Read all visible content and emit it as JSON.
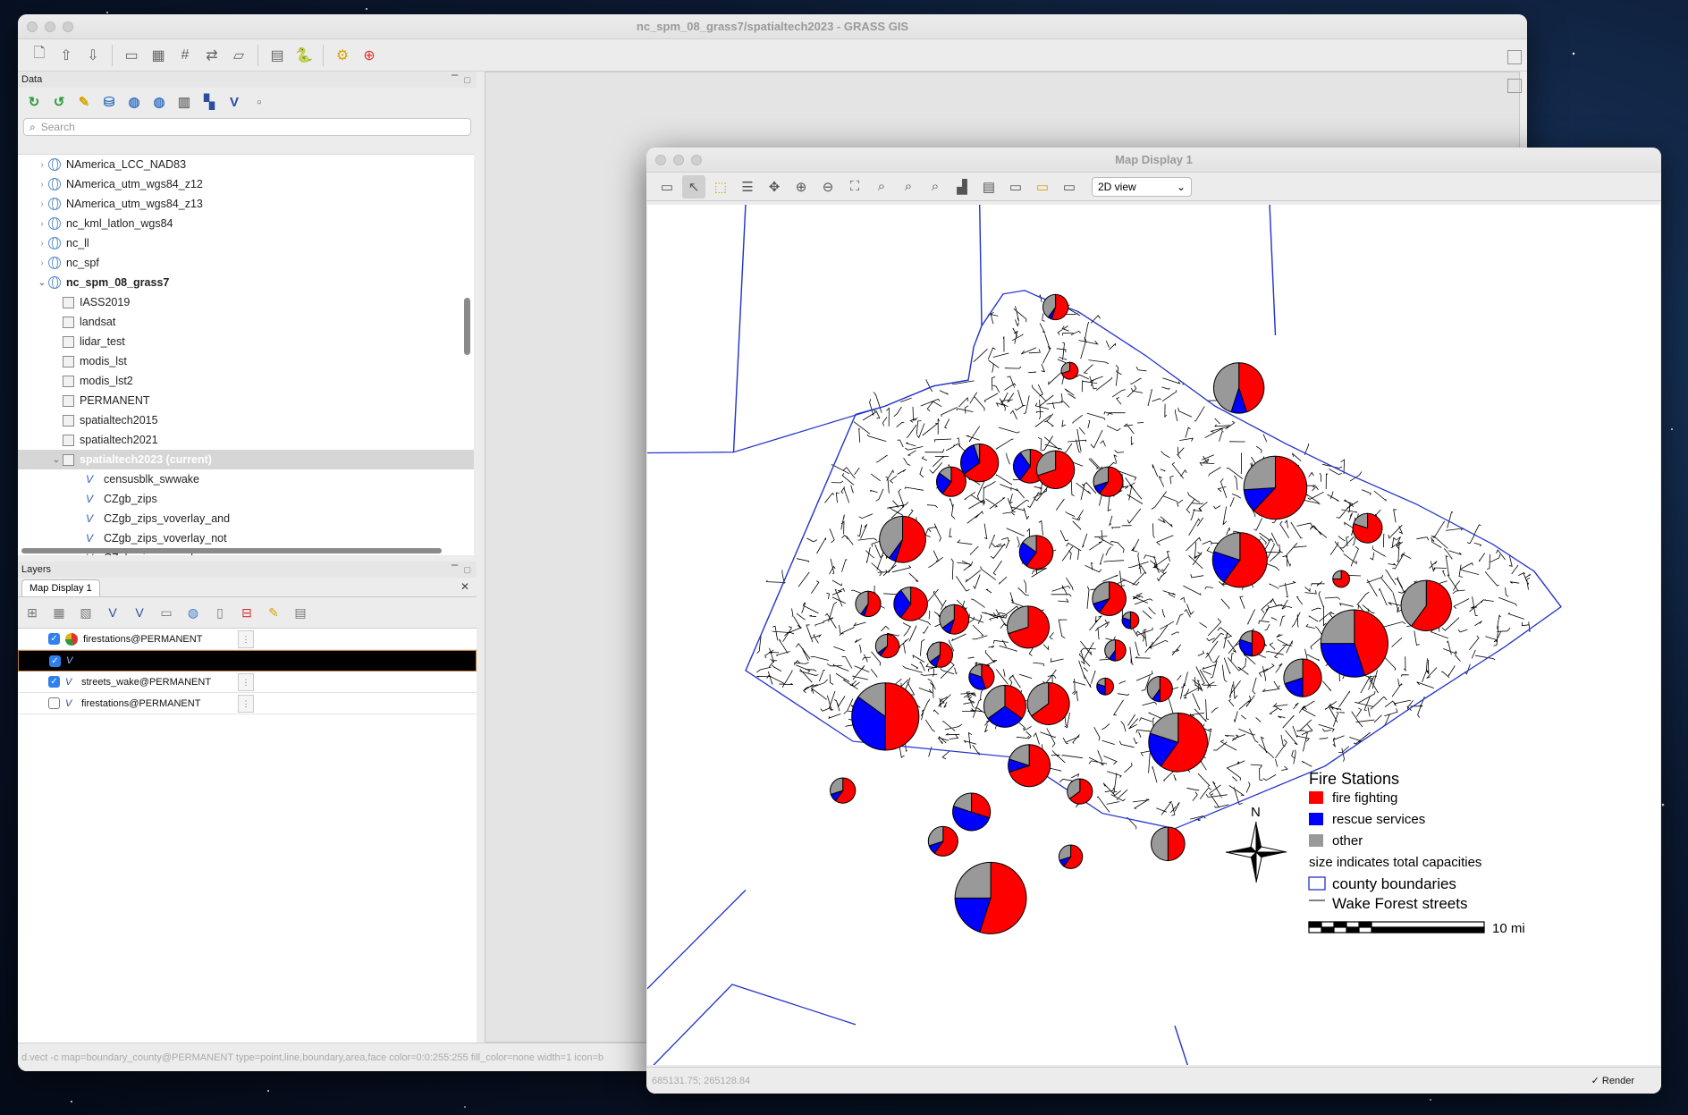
{
  "main_window": {
    "title": "nc_spm_08_grass7/spatialtech2023 - GRASS GIS",
    "status_command": "d.vect -c map=boundary_county@PERMANENT type=point,line,boundary,area,face color=0:0:255:255 fill_color=none width=1 icon=b"
  },
  "data_panel": {
    "title": "Data",
    "search_placeholder": "Search",
    "tree": [
      {
        "label": "NAmerica_LCC_NAD83",
        "kind": "location",
        "level": 0,
        "expanded": false
      },
      {
        "label": "NAmerica_utm_wgs84_z12",
        "kind": "location",
        "level": 0,
        "expanded": false
      },
      {
        "label": "NAmerica_utm_wgs84_z13",
        "kind": "location",
        "level": 0,
        "expanded": false
      },
      {
        "label": "nc_kml_latlon_wgs84",
        "kind": "location",
        "level": 0,
        "expanded": false
      },
      {
        "label": "nc_ll",
        "kind": "location",
        "level": 0,
        "expanded": false
      },
      {
        "label": "nc_spf",
        "kind": "location",
        "level": 0,
        "expanded": false
      },
      {
        "label": "nc_spm_08_grass7",
        "kind": "location",
        "level": 0,
        "expanded": true,
        "bold": true
      },
      {
        "label": "IASS2019",
        "kind": "mapset",
        "level": 1
      },
      {
        "label": "landsat",
        "kind": "mapset",
        "level": 1
      },
      {
        "label": "lidar_test",
        "kind": "mapset",
        "level": 1
      },
      {
        "label": "modis_lst",
        "kind": "mapset",
        "level": 1
      },
      {
        "label": "modis_lst2",
        "kind": "mapset",
        "level": 1
      },
      {
        "label": "PERMANENT",
        "kind": "mapset",
        "level": 1
      },
      {
        "label": "spatialtech2015",
        "kind": "mapset",
        "level": 1
      },
      {
        "label": "spatialtech2021",
        "kind": "mapset",
        "level": 1
      },
      {
        "label": "spatialtech2023  (current)",
        "kind": "mapset",
        "level": 1,
        "current": true,
        "expanded": true
      },
      {
        "label": "censusblk_swwake",
        "kind": "vector",
        "level": 2
      },
      {
        "label": "CZgb_zips",
        "kind": "vector",
        "level": 2
      },
      {
        "label": "CZgb_zips_voverlay_and",
        "kind": "vector",
        "level": 2
      },
      {
        "label": "CZgb_zips_voverlay_not",
        "kind": "vector",
        "level": 2
      },
      {
        "label": "CZgb_zips_voverlay_or",
        "kind": "vector",
        "level": 2
      }
    ]
  },
  "layers_panel": {
    "title": "Layers",
    "tab_label": "Map Display 1",
    "layers": [
      {
        "name": "firestations@PERMANENT",
        "checked": true,
        "icon": "pie-chart-icon",
        "selected": false
      },
      {
        "name": "",
        "checked": true,
        "icon": "vector-icon",
        "selected": true
      },
      {
        "name": "streets_wake@PERMANENT",
        "checked": true,
        "icon": "vector-icon",
        "selected": false
      },
      {
        "name": "firestations@PERMANENT",
        "checked": false,
        "icon": "vector-icon",
        "selected": false
      }
    ]
  },
  "map_window": {
    "title": "Map Display 1",
    "view_mode": "2D view",
    "coordinates": "685131.75; 265128.84",
    "render_label": "Render",
    "render_checked": true
  },
  "legend": {
    "title": "Fire Stations",
    "items": [
      {
        "label": "fire fighting",
        "color": "#ff0000"
      },
      {
        "label": "rescue services",
        "color": "#0000ff"
      },
      {
        "label": "other",
        "color": "#999999"
      }
    ],
    "size_note": "size indicates total capacities",
    "county_label": "county boundaries",
    "streets_label": "Wake Forest streets",
    "scale_label": "10 mi",
    "north_label": "N"
  },
  "firestations": [
    {
      "lon": 0.403,
      "lat": 0.119,
      "r": 3,
      "fire": 0.55,
      "rescue": 0.05
    },
    {
      "lon": 0.417,
      "lat": 0.193,
      "r": 2,
      "fire": 0.7,
      "rescue": 0.0
    },
    {
      "lon": 0.584,
      "lat": 0.213,
      "r": 6,
      "fire": 0.45,
      "rescue": 0.1
    },
    {
      "lon": 0.378,
      "lat": 0.304,
      "r": 4,
      "fire": 0.6,
      "rescue": 0.3
    },
    {
      "lon": 0.403,
      "lat": 0.308,
      "r": 4.5,
      "fire": 0.7,
      "rescue": 0.0
    },
    {
      "lon": 0.328,
      "lat": 0.3,
      "r": 4.5,
      "fire": 0.65,
      "rescue": 0.3
    },
    {
      "lon": 0.3,
      "lat": 0.322,
      "r": 3.5,
      "fire": 0.6,
      "rescue": 0.25
    },
    {
      "lon": 0.455,
      "lat": 0.322,
      "r": 3.5,
      "fire": 0.6,
      "rescue": 0.1
    },
    {
      "lon": 0.62,
      "lat": 0.329,
      "r": 7.5,
      "fire": 0.62,
      "rescue": 0.12
    },
    {
      "lon": 0.252,
      "lat": 0.389,
      "r": 5.5,
      "fire": 0.55,
      "rescue": 0.05
    },
    {
      "lon": 0.384,
      "lat": 0.404,
      "r": 4,
      "fire": 0.6,
      "rescue": 0.25
    },
    {
      "lon": 0.711,
      "lat": 0.376,
      "r": 3.5,
      "fire": 0.8,
      "rescue": 0.0
    },
    {
      "lon": 0.585,
      "lat": 0.413,
      "r": 6.5,
      "fire": 0.6,
      "rescue": 0.2
    },
    {
      "lon": 0.685,
      "lat": 0.435,
      "r": 2,
      "fire": 0.75,
      "rescue": 0.0
    },
    {
      "lon": 0.456,
      "lat": 0.458,
      "r": 4,
      "fire": 0.6,
      "rescue": 0.1
    },
    {
      "lon": 0.769,
      "lat": 0.466,
      "r": 6,
      "fire": 0.6,
      "rescue": 0.0
    },
    {
      "lon": 0.26,
      "lat": 0.464,
      "r": 4,
      "fire": 0.6,
      "rescue": 0.3
    },
    {
      "lon": 0.218,
      "lat": 0.464,
      "r": 3,
      "fire": 0.55,
      "rescue": 0.05
    },
    {
      "lon": 0.303,
      "lat": 0.482,
      "r": 3.5,
      "fire": 0.55,
      "rescue": 0.1
    },
    {
      "lon": 0.376,
      "lat": 0.491,
      "r": 5,
      "fire": 0.7,
      "rescue": 0.0
    },
    {
      "lon": 0.477,
      "lat": 0.483,
      "r": 2,
      "fire": 0.5,
      "rescue": 0.3
    },
    {
      "lon": 0.597,
      "lat": 0.51,
      "r": 3,
      "fire": 0.5,
      "rescue": 0.3
    },
    {
      "lon": 0.698,
      "lat": 0.51,
      "r": 8,
      "fire": 0.45,
      "rescue": 0.3
    },
    {
      "lon": 0.237,
      "lat": 0.513,
      "r": 2.8,
      "fire": 0.6,
      "rescue": 0.05
    },
    {
      "lon": 0.289,
      "lat": 0.523,
      "r": 3,
      "fire": 0.55,
      "rescue": 0.1
    },
    {
      "lon": 0.33,
      "lat": 0.549,
      "r": 3,
      "fire": 0.45,
      "rescue": 0.35
    },
    {
      "lon": 0.462,
      "lat": 0.518,
      "r": 2.5,
      "fire": 0.5,
      "rescue": 0.1
    },
    {
      "lon": 0.647,
      "lat": 0.55,
      "r": 4.5,
      "fire": 0.5,
      "rescue": 0.2
    },
    {
      "lon": 0.235,
      "lat": 0.595,
      "r": 8,
      "fire": 0.5,
      "rescue": 0.35
    },
    {
      "lon": 0.353,
      "lat": 0.583,
      "r": 5,
      "fire": 0.35,
      "rescue": 0.3
    },
    {
      "lon": 0.396,
      "lat": 0.58,
      "r": 5,
      "fire": 0.65,
      "rescue": 0.0
    },
    {
      "lon": 0.452,
      "lat": 0.56,
      "r": 2,
      "fire": 0.5,
      "rescue": 0.3
    },
    {
      "lon": 0.506,
      "lat": 0.563,
      "r": 3,
      "fire": 0.5,
      "rescue": 0.1
    },
    {
      "lon": 0.524,
      "lat": 0.625,
      "r": 7,
      "fire": 0.6,
      "rescue": 0.2
    },
    {
      "lon": 0.377,
      "lat": 0.652,
      "r": 5,
      "fire": 0.7,
      "rescue": 0.1
    },
    {
      "lon": 0.193,
      "lat": 0.681,
      "r": 3,
      "fire": 0.6,
      "rescue": 0.1
    },
    {
      "lon": 0.427,
      "lat": 0.682,
      "r": 3,
      "fire": 0.65,
      "rescue": 0.0
    },
    {
      "lon": 0.32,
      "lat": 0.706,
      "r": 4.5,
      "fire": 0.3,
      "rescue": 0.5
    },
    {
      "lon": 0.292,
      "lat": 0.74,
      "r": 3.5,
      "fire": 0.6,
      "rescue": 0.1
    },
    {
      "lon": 0.514,
      "lat": 0.743,
      "r": 4,
      "fire": 0.5,
      "rescue": 0.0
    },
    {
      "lon": 0.418,
      "lat": 0.758,
      "r": 2.8,
      "fire": 0.6,
      "rescue": 0.1
    },
    {
      "lon": 0.339,
      "lat": 0.806,
      "r": 8.5,
      "fire": 0.55,
      "rescue": 0.2
    }
  ]
}
